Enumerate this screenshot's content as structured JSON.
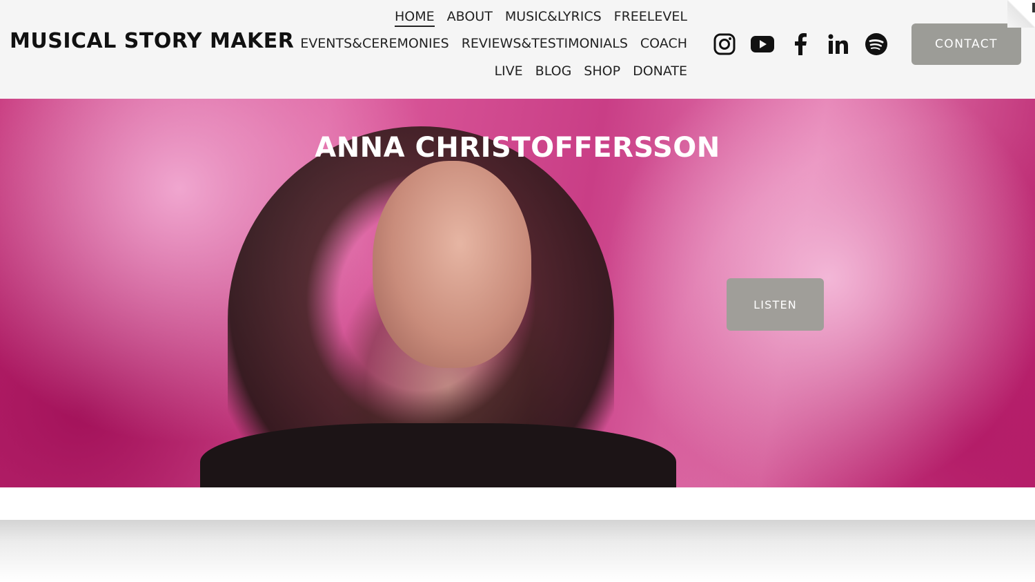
{
  "header": {
    "site_title": "MUSICAL STORY MAKER",
    "nav_row1": [
      "HOME",
      "ABOUT",
      "MUSIC&LYRICS",
      "FREELEVEL"
    ],
    "nav_row2": [
      "EVENTS&CEREMONIES",
      "REVIEWS&TESTIMONIALS",
      "COACH"
    ],
    "nav_row3": [
      "LIVE",
      "BLOG",
      "SHOP",
      "DONATE"
    ],
    "active_nav": "HOME",
    "socials": [
      "instagram-icon",
      "youtube-icon",
      "facebook-icon",
      "linkedin-icon",
      "spotify-icon"
    ],
    "contact_label": "CONTACT"
  },
  "hero": {
    "title": "ANNA CHRISTOFFERSSON",
    "listen_label": "LISTEN"
  },
  "colors": {
    "header_bg": "#f5f5f5",
    "button_bg": "#9c9c97",
    "hero_accent": "#c93e86",
    "text": "#111111"
  }
}
